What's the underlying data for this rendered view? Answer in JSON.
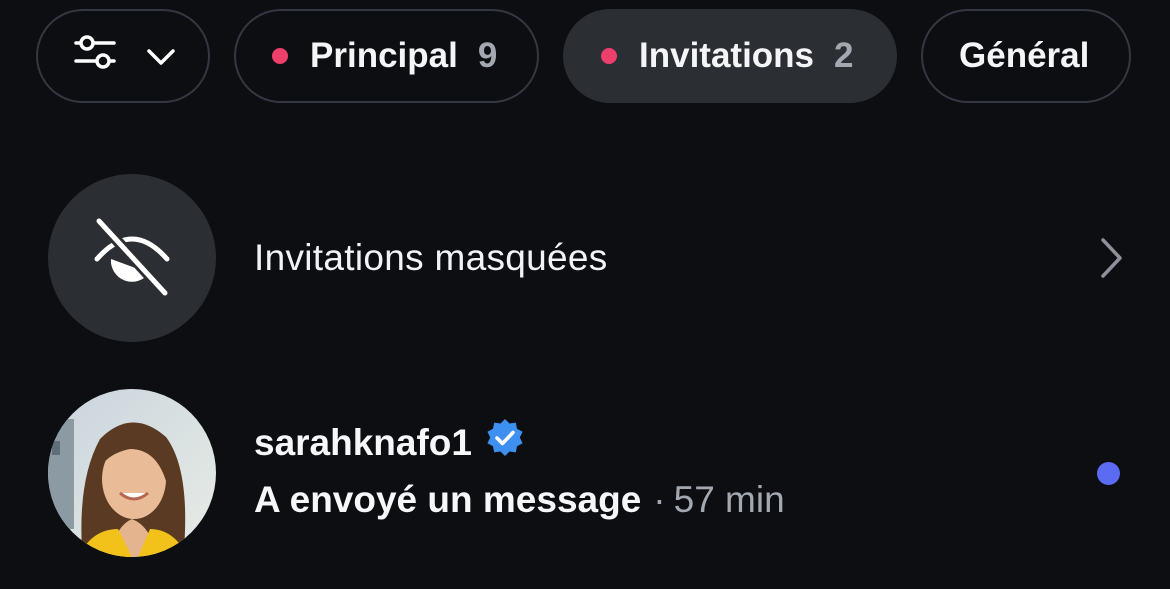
{
  "tabs": [
    {
      "label": "Principal",
      "count": "9"
    },
    {
      "label": "Invitations",
      "count": "2"
    },
    {
      "label": "Général"
    }
  ],
  "hidden_requests": {
    "label": "Invitations masquées"
  },
  "conversation": {
    "username": "sarahknafo1",
    "preview": "A envoyé un message",
    "separator": "·",
    "time": "57 min"
  },
  "colors": {
    "background": "#0c0e12",
    "unread_tab_dot": "#ee3f6b",
    "verified_badge": "#3d8ff0",
    "unread_message_dot": "#5b6cf3"
  },
  "icons": [
    "sliders-icon",
    "chevron-down-icon",
    "eye-off-icon",
    "chevron-right-icon",
    "verified-badge-icon"
  ]
}
